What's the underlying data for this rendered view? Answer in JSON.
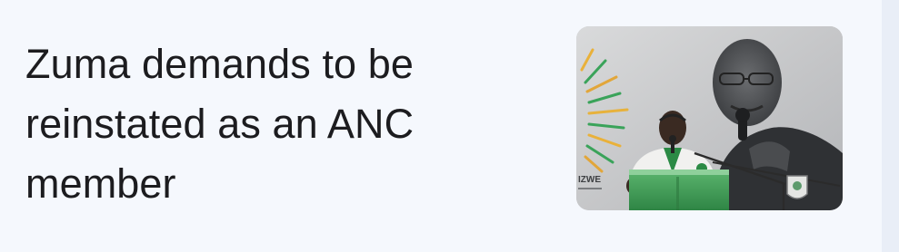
{
  "article": {
    "headline": "Zuma demands to be reinstated as an ANC member",
    "image": {
      "alt": "Jacob Zuma speaking at a podium",
      "backdrop_text": "IZWE"
    }
  },
  "colors": {
    "card_background": "#f5f8fd",
    "headline_text": "#1c1c1f",
    "podium_green": "#3f9a55"
  }
}
